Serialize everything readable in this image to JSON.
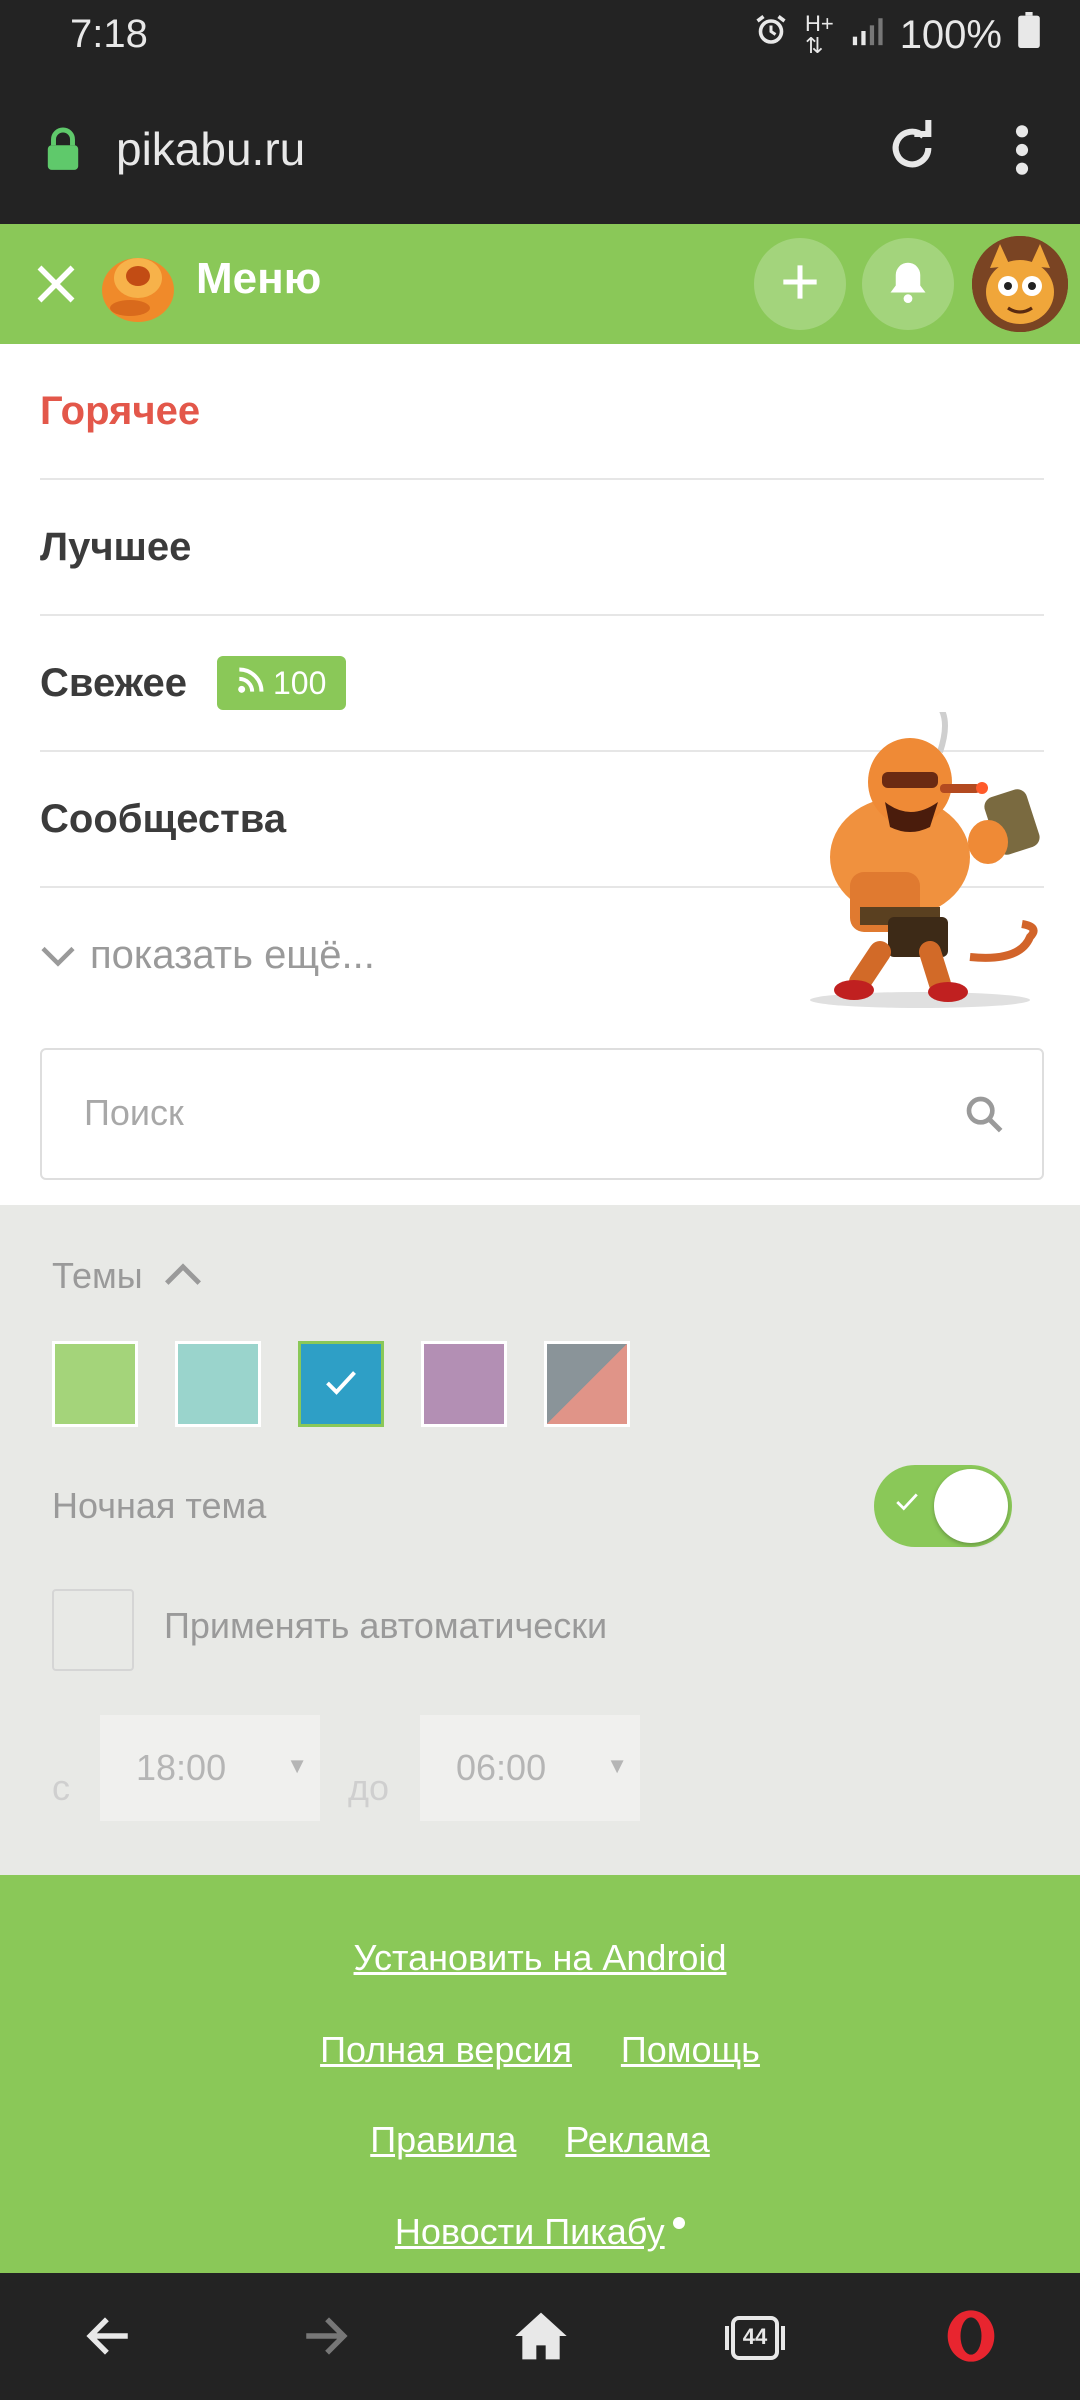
{
  "status": {
    "time": "7:18",
    "battery": "100%"
  },
  "address_bar": {
    "url": "pikabu.ru"
  },
  "header": {
    "title": "Меню"
  },
  "menu": {
    "items": [
      {
        "label": "Горячее"
      },
      {
        "label": "Лучшее"
      },
      {
        "label": "Свежее",
        "badge": "100"
      },
      {
        "label": "Сообщества"
      }
    ],
    "show_more": "показать ещё..."
  },
  "search": {
    "placeholder": "Поиск"
  },
  "themes": {
    "label": "Темы",
    "swatch_colors": [
      "#a4d47a",
      "#9ad4cc",
      "#2e9fc6",
      "#b38fb4",
      "#8a9499"
    ],
    "night_label": "Ночная тема",
    "auto_label": "Применять автоматически",
    "from_label": "с",
    "from_value": "18:00",
    "to_label": "до",
    "to_value": "06:00"
  },
  "footer": {
    "install": "Установить на Android",
    "full_version": "Полная версия",
    "help": "Помощь",
    "rules": "Правила",
    "ads": "Реклама",
    "news": "Новости Пикабу"
  },
  "bottom_nav": {
    "tabs_count": "44"
  },
  "colors": {
    "brand_green": "#8ac858",
    "hot_red": "#e3574a",
    "dark_bar": "#232323"
  }
}
